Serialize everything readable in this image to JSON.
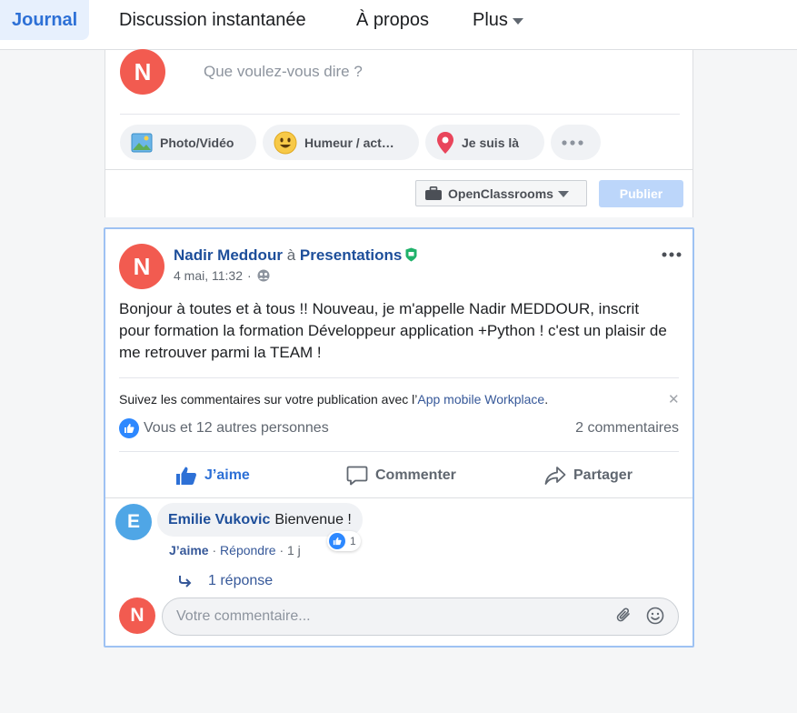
{
  "nav": {
    "tabs": [
      {
        "label": "Journal",
        "active": true
      },
      {
        "label": "Discussion instantanée"
      },
      {
        "label": "À propos"
      },
      {
        "label": "Plus"
      }
    ]
  },
  "composer": {
    "avatar_letter": "N",
    "placeholder": "Que voulez-vous dire ?",
    "options": [
      "Photo/Vidéo",
      "Humeur / act…",
      "Je suis là"
    ],
    "more_icon": "more-horizontal-icon",
    "group_select": "OpenClassrooms",
    "publish_label": "Publier"
  },
  "post": {
    "avatar_letter": "N",
    "author": "Nadir Meddour",
    "separator": "à",
    "group": "Presentations",
    "time": "4 mai, 11:32",
    "audience_icon": "group-icon",
    "text": "Bonjour à toutes et à tous !! Nouveau, je m'appelle Nadir MEDDOUR, inscrit pour formation la formation Développeur application +Python ! c'est un plaisir de me retrouver parmi la TEAM !",
    "notice_text": "Suivez les commentaires sur votre publication avec l’",
    "notice_link": "App mobile Workplace",
    "notice_end": ".",
    "reactions_text": "Vous et 12 autres personnes",
    "comments_count": "2 commentaires",
    "actions": {
      "like": "J’aime",
      "comment": "Commenter",
      "share": "Partager"
    }
  },
  "comment": {
    "avatar_letter": "E",
    "author": "Emilie Vukovic",
    "text": "Bienvenue !",
    "reaction_count": "1",
    "like": "J’aime",
    "reply": "Répondre",
    "dot": "·",
    "time": "1 j",
    "replies": "1 réponse"
  },
  "comment_composer": {
    "avatar_letter": "N",
    "placeholder": "Votre commentaire..."
  },
  "colors": {
    "accent": "#2d70d6",
    "avatar_red": "#f25b50",
    "avatar_blue": "#4fa6e6",
    "link": "#365899"
  }
}
